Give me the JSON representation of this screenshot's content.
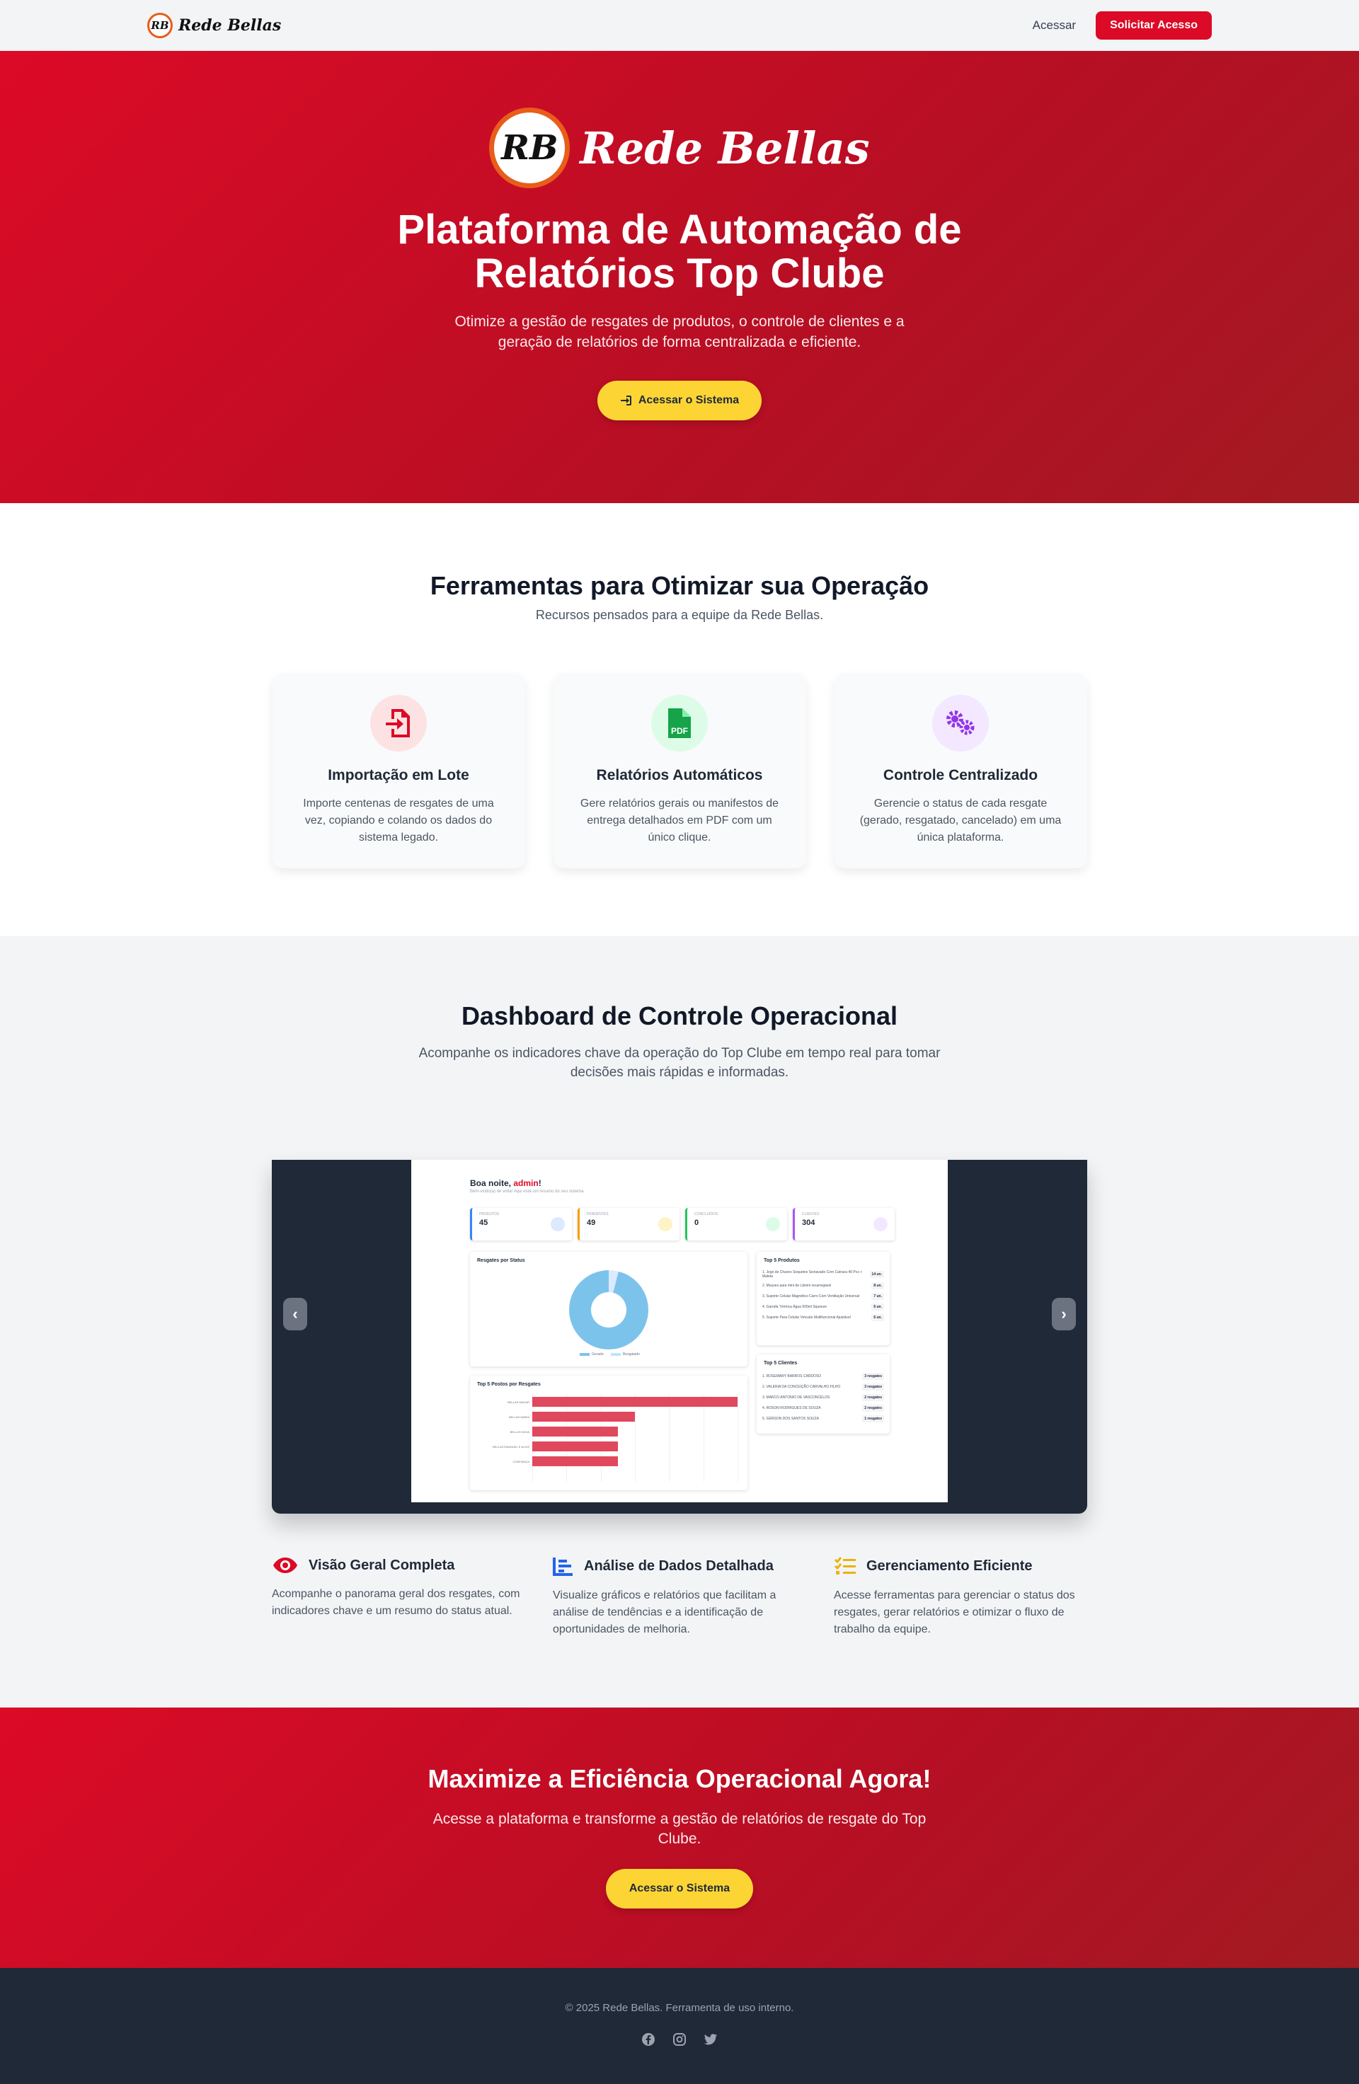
{
  "nav": {
    "brand_initials": "RB",
    "brand_name": "Rede Bellas",
    "login_label": "Acessar",
    "request_label": "Solicitar Acesso"
  },
  "hero": {
    "brand_initials": "RB",
    "brand_name": "Rede Bellas",
    "title": "Plataforma de Automação de Relatórios Top Clube",
    "subtitle": "Otimize a gestão de resgates de produtos, o controle de clientes e a geração de relatórios de forma centralizada e eficiente.",
    "cta_label": "Acessar o Sistema"
  },
  "features": {
    "title": "Ferramentas para Otimizar sua Operação",
    "subtitle": "Recursos pensados para a equipe da Rede Bellas.",
    "cards": [
      {
        "icon": "file-import-icon",
        "title": "Importação em Lote",
        "text": "Importe centenas de resgates de uma vez, copiando e colando os dados do sistema legado.",
        "color": "#dc0a26",
        "bg": "#fde2e4"
      },
      {
        "icon": "file-pdf-icon",
        "title": "Relatórios Automáticos",
        "text": "Gere relatórios gerais ou manifestos de entrega detalhados em PDF com um único clique.",
        "color": "#16a34a",
        "bg": "#dcfce7"
      },
      {
        "icon": "gears-icon",
        "title": "Controle Centralizado",
        "text": "Gerencie o status de cada resgate (gerado, resgatado, cancelado) em uma única plataforma.",
        "color": "#9333ea",
        "bg": "#f3e8ff"
      }
    ]
  },
  "dashboard": {
    "title": "Dashboard de Controle Operacional",
    "subtitle": "Acompanhe os indicadores chave da operação do Top Clube em tempo real para tomar decisões mais rápidas e informadas.",
    "prev_label": "‹",
    "next_label": "›",
    "mock": {
      "greeting": "Boa noite, ",
      "user": "admin",
      "greeting_end": "!",
      "greeting_sub": "Bem-vindo(a) de volta! Aqui está um resumo do seu sistema.",
      "stats": [
        {
          "label": "PRODUTOS",
          "value": "45",
          "color": "#3b82f6",
          "icon_bg": "#dbeafe"
        },
        {
          "label": "PENDENTES",
          "value": "49",
          "color": "#f59e0b",
          "icon_bg": "#fef3c7"
        },
        {
          "label": "CONCLUÍDOS",
          "value": "0",
          "color": "#22c55e",
          "icon_bg": "#dcfce7"
        },
        {
          "label": "CLIENTES",
          "value": "304",
          "color": "#a855f7",
          "icon_bg": "#f3e8ff"
        }
      ],
      "status_chart": {
        "title": "Resgates por Status",
        "legend": [
          "Gerado",
          "Resgatado"
        ]
      },
      "top_products": {
        "title": "Top 5 Produtos",
        "items": [
          {
            "name": "1. Jogo de Chaves Soquetes Sextavado Com Catraca 40 Pcs + Maleta",
            "count": "14 un."
          },
          {
            "name": "2. Mouses para mini de Lâmini recarregável",
            "count": "8 un."
          },
          {
            "name": "3. Suporte Celular Magnético Carro Com Ventilação Universal",
            "count": "7 un."
          },
          {
            "name": "4. Garrafa Térmica Água 500ml Squeeze",
            "count": "6 un."
          },
          {
            "name": "5. Suporte Para Celular Veicular Multifuncional Ajustável",
            "count": "6 un."
          }
        ]
      },
      "top_clients": {
        "title": "Top 5 Clientes",
        "items": [
          {
            "name": "1. ROSEMARY BARROS CARDOSO",
            "count": "3 resgates"
          },
          {
            "name": "2. VALERIA DA CONCEIÇÃO CARVALHO FILHO",
            "count": "3 resgates"
          },
          {
            "name": "3. MARCO ANTONIO DE VASCONCELOS",
            "count": "2 resgates"
          },
          {
            "name": "4. ROSON RODRIGUES DE SOUZA",
            "count": "2 resgates"
          },
          {
            "name": "5. GERSON DOS SANTOS SOUZA",
            "count": "1 resgates"
          }
        ]
      },
      "stores_chart": {
        "title": "Top 5 Postos por Resgates",
        "stores": [
          "BELLAS MAGAR",
          "BELLAS MARIA",
          "BELLAS NOVA",
          "BELLAS EMANUEL E ALOIS",
          "CONFIANÇA"
        ],
        "values": [
          12,
          6,
          5,
          5,
          5
        ],
        "xmax": 12
      }
    },
    "highlights": [
      {
        "icon": "eye-icon",
        "title": "Visão Geral Completa",
        "text": "Acompanhe o panorama geral dos resgates, com indicadores chave e um resumo do status atual.",
        "color": "#dc0a26"
      },
      {
        "icon": "chart-bar-icon",
        "title": "Análise de Dados Detalhada",
        "text": "Visualize gráficos e relatórios que facilitam a análise de tendências e a identificação de oportunidades de melhoria.",
        "color": "#2563eb"
      },
      {
        "icon": "list-check-icon",
        "title": "Gerenciamento Eficiente",
        "text": "Acesse ferramentas para gerenciar o status dos resgates, gerar relatórios e otimizar o fluxo de trabalho da equipe.",
        "color": "#eab308"
      }
    ]
  },
  "cta": {
    "title": "Maximize a Eficiência Operacional Agora!",
    "subtitle": "Acesse a plataforma e transforme a gestão de relatórios de resgate do Top Clube.",
    "button_label": "Acessar o Sistema"
  },
  "footer": {
    "text": "© 2025 Rede Bellas. Ferramenta de uso interno.",
    "socials": [
      "facebook-icon",
      "instagram-icon",
      "twitter-icon"
    ]
  }
}
